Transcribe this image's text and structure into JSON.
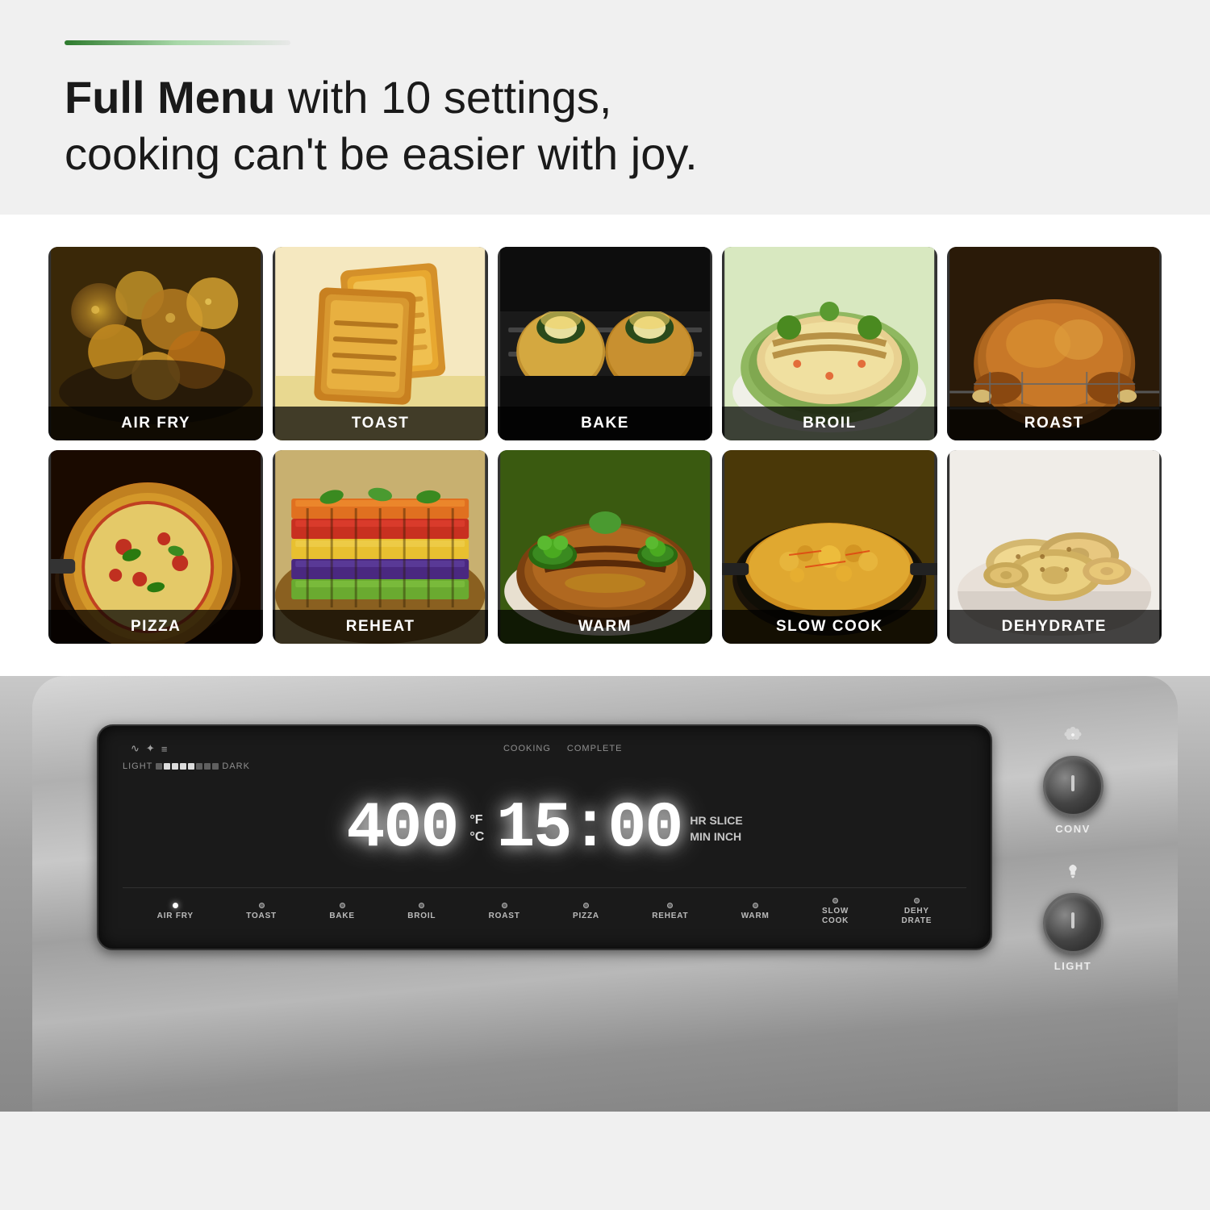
{
  "header": {
    "green_bar_label": "green-accent-bar",
    "headline_bold": "Full Menu",
    "headline_rest": " with 10 settings,\ncooking can't be easier with joy."
  },
  "grid": {
    "items": [
      {
        "id": "air-fry",
        "label": "AIR FRY",
        "color_class": "food-airfry"
      },
      {
        "id": "toast",
        "label": "TOAST",
        "color_class": "food-toast"
      },
      {
        "id": "bake",
        "label": "BAKE",
        "color_class": "food-bake"
      },
      {
        "id": "broil",
        "label": "BROIL",
        "color_class": "food-broil"
      },
      {
        "id": "roast",
        "label": "ROAST",
        "color_class": "food-roast"
      },
      {
        "id": "pizza",
        "label": "PIZZA",
        "color_class": "food-pizza"
      },
      {
        "id": "reheat",
        "label": "REHEAT",
        "color_class": "food-reheat"
      },
      {
        "id": "warm",
        "label": "WARM",
        "color_class": "food-warm"
      },
      {
        "id": "slow-cook",
        "label": "SLOW COOK",
        "color_class": "food-slowcook"
      },
      {
        "id": "dehydrate",
        "label": "DEHYDRATE",
        "color_class": "food-dehydrate"
      }
    ]
  },
  "appliance": {
    "display": {
      "temperature": "400°F",
      "temp_unit_top": "°F",
      "temp_unit_bottom": "°C",
      "time": "15:00",
      "time_unit_top": "HR SLICE",
      "time_unit_bottom": "MIN INCH",
      "status_left_top": "COOKING",
      "status_left_bottom": "LIGHT",
      "status_right_top": "COMPLETE",
      "status_right_bottom": "DARK"
    },
    "modes": [
      {
        "id": "air-fry",
        "label": "AIR FRY",
        "active": true
      },
      {
        "id": "toast",
        "label": "TOAST",
        "active": false
      },
      {
        "id": "bake",
        "label": "BAKE",
        "active": false
      },
      {
        "id": "broil",
        "label": "BROIL",
        "active": false
      },
      {
        "id": "roast",
        "label": "ROAST",
        "active": false
      },
      {
        "id": "pizza",
        "label": "PIZZA",
        "active": false
      },
      {
        "id": "reheat",
        "label": "REHEAT",
        "active": false
      },
      {
        "id": "warm",
        "label": "WARM",
        "active": false
      },
      {
        "id": "slow-cook",
        "label": "SLOW\nCOOK",
        "active": false
      },
      {
        "id": "dehy-drate",
        "label": "DEHY\nDRATE",
        "active": false
      }
    ],
    "right_controls": [
      {
        "id": "conv",
        "icon": "❄",
        "label": "CONV"
      },
      {
        "id": "light",
        "icon": "🔔",
        "label": "LIGHT"
      }
    ]
  }
}
